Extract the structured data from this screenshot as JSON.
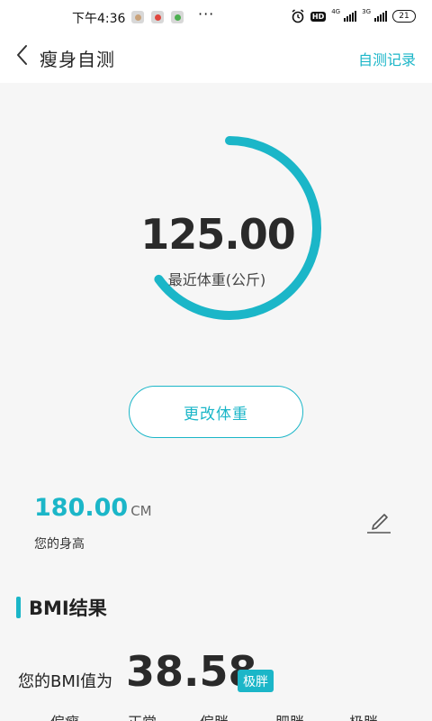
{
  "status_bar": {
    "time": "下午4:36",
    "dots": "···",
    "hd": "HD",
    "net1": "4G",
    "net2": "3G",
    "battery": "21"
  },
  "header": {
    "title": "瘦身自测",
    "record_link": "自测记录"
  },
  "weight": {
    "value": "125.00",
    "label": "最近体重(公斤)",
    "progress": 0.65
  },
  "change_button": "更改体重",
  "height": {
    "value": "180.00",
    "unit": "CM",
    "label": "您的身高"
  },
  "bmi": {
    "section_title": "BMI结果",
    "prefix": "您的BMI值为",
    "value": "38.58",
    "badge": "极胖",
    "scale": [
      "偏瘦",
      "正常",
      "偏胖",
      "肥胖",
      "极胖"
    ]
  },
  "colors": {
    "accent": "#1bb6c8"
  }
}
